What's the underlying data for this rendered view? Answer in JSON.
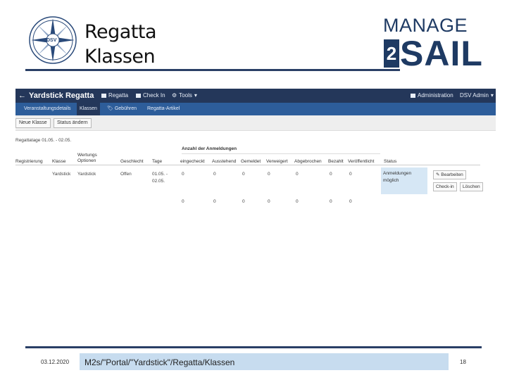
{
  "slide": {
    "title_line1": "Regatta",
    "title_line2": "Klassen",
    "logo_left": {
      "letters": "DSV"
    },
    "logo_right": {
      "line1": "MANAGE",
      "two": "2",
      "line2": "SAIL"
    }
  },
  "app": {
    "back_icon": "←",
    "title": "Yardstick Regatta",
    "topnav": [
      {
        "icon": "grid-icon",
        "label": "Regatta"
      },
      {
        "icon": "checkin-icon",
        "label": "Check In"
      },
      {
        "icon": "gear-icon",
        "label": "Tools"
      }
    ],
    "topnav_right": [
      {
        "icon": "grid-icon",
        "label": "Administration"
      },
      {
        "label": "DSV Admin"
      }
    ],
    "subnav": [
      "Veranstaltungsdetails",
      "Klassen",
      "Gebühren",
      "Regatta-Artikel"
    ],
    "active_subnav": "Klassen",
    "toolbar": {
      "new_class": "Neue Klasse",
      "change_status": "Status ändern"
    },
    "regatta_days": "Regattatage 01.05. - 02.05.",
    "group_header": "Anzahl der Anmeldungen",
    "columns": [
      "Registrierung",
      "Klasse",
      "Wertungs Optionen",
      "Geschlecht",
      "Tage",
      "eingecheckt",
      "Ausstehend",
      "Gemeldet",
      "Verweigert",
      "Abgebrochen",
      "Bezahlt",
      "Veröffentlicht",
      "Status"
    ],
    "row": {
      "klasse": "Yardstick",
      "wertung": "Yardstick",
      "geschlecht": "Offen",
      "tage_l1": "01.05. -",
      "tage_l2": "02.05.",
      "counts": [
        "0",
        "0",
        "0",
        "0",
        "0",
        "0",
        "0"
      ],
      "status_l1": "Anmeldungen",
      "status_l2": "möglich",
      "btn_edit": "Bearbeiten",
      "btn_checkin": "Check-in",
      "btn_delete": "Löschen"
    },
    "totals": [
      "0",
      "0",
      "0",
      "0",
      "0",
      "0",
      "0"
    ]
  },
  "footer": {
    "date": "03.12.2020",
    "path": "M2s/\"Portal/\"Yardstick\"/Regatta/Klassen",
    "page": "18"
  },
  "colors": {
    "navy": "#24375a",
    "blue": "#2d5d9a",
    "status_bg": "#d6e7f5",
    "footer_box": "#c7dcef"
  }
}
